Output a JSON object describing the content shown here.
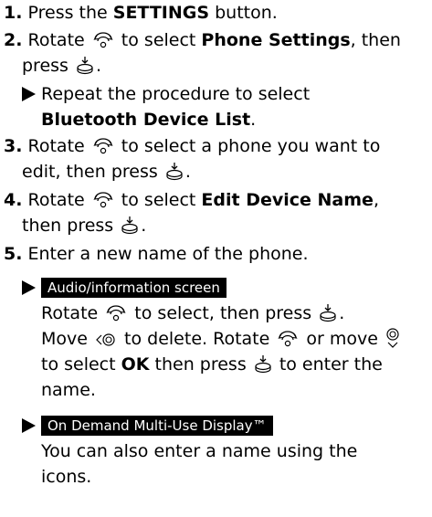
{
  "steps": [
    {
      "num": "1.",
      "pre": "Press the ",
      "bold": "SETTINGS",
      "post": " button."
    },
    {
      "num": "2.",
      "pre": "Rotate",
      "mid": " to select ",
      "bold": "Phone Settings",
      "post": ", then",
      "line2": "press"
    },
    {
      "sub_pre": "Repeat the procedure to select",
      "sub_bold": "Bluetooth Device List",
      "sub_post": "."
    },
    {
      "num": "3.",
      "pre": "Rotate",
      "mid": " to select a phone you want to",
      "line2": "edit, then press"
    },
    {
      "num": "4.",
      "pre": "Rotate",
      "mid": " to select ",
      "bold": "Edit Device Name",
      "post": ",",
      "line2": "then press"
    },
    {
      "num": "5.",
      "text": "Enter a new name of the phone."
    }
  ],
  "audio": {
    "banner": "Audio/information screen",
    "l1_a": "Rotate",
    "l1_b": " to select, then press",
    "l1_c": ".",
    "l2_a": "Move",
    "l2_b": " to delete. Rotate",
    "l2_c": " or move",
    "l3_a": "to select ",
    "l3_bold": "OK",
    "l3_b": " then press",
    "l3_c": " to enter the",
    "l4": "name."
  },
  "ondemand": {
    "banner": "On Demand Multi-Use Display™",
    "l1": "You can also enter a name using the",
    "l2": "icons."
  },
  "icons": {
    "rotate": "rotate-knob-icon",
    "press": "press-knob-icon",
    "move_left": "move-left-icon",
    "move_vertical": "move-up-down-icon"
  }
}
